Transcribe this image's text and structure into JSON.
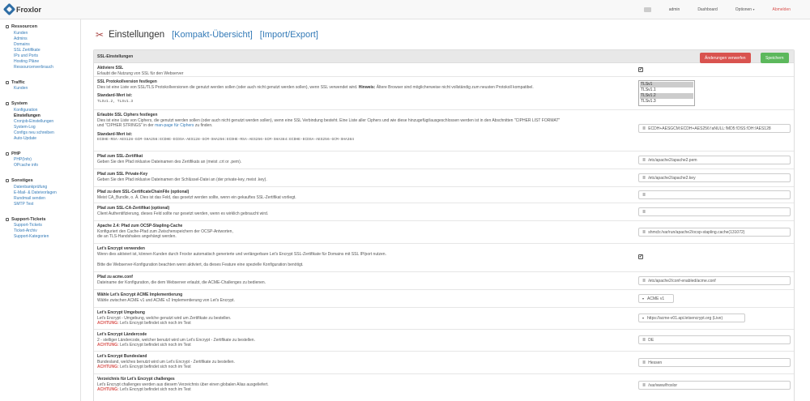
{
  "brand": {
    "name": "Froxlor"
  },
  "nav": {
    "user": "admin",
    "dashboard": "Dashboard",
    "options": "Optionen",
    "logout": "Abmelden"
  },
  "sidebar": [
    {
      "head": "Ressourcen",
      "items": [
        "Kunden",
        "Admins",
        "Domains",
        "SSL Zertifikate",
        "IPs und Ports",
        "Hosting Pläne",
        "Ressourcenverbrauch"
      ]
    },
    {
      "head": "Traffic",
      "items": [
        "Kunden"
      ]
    },
    {
      "head": "System",
      "items": [
        "Konfiguration",
        "Einstellungen",
        "Cronjob-Einstellungen",
        "System-Log",
        "Configs neu schreiben",
        "Auto-Update"
      ],
      "active": "Einstellungen"
    },
    {
      "head": "PHP",
      "items": [
        "PHP(Info)",
        "OPcache info"
      ]
    },
    {
      "head": "Sonstiges",
      "items": [
        "Datenbankprüfung",
        "E-Mail- & Dateivorlagen",
        "Rundmail senden",
        "SMTP Test"
      ]
    },
    {
      "head": "Support-Tickets",
      "items": [
        "Support-Tickets",
        "Ticket-Archiv",
        "Support-Kategorien"
      ]
    }
  ],
  "page": {
    "title": "Einstellungen",
    "compact_link": "[Kompakt-Übersicht]",
    "import_link": "[Import/Export]"
  },
  "panel": {
    "title": "SSL-Einstellungen",
    "discard": "Änderungen verwerfen",
    "save": "Speichern"
  },
  "settings": {
    "activate_ssl": {
      "title": "Aktiviere SSL",
      "desc": "Erlaubt die Nutzung von SSL für den Webserver",
      "checked": "✔"
    },
    "protocol": {
      "title": "SSL Protokollversion festlegen",
      "desc": "Dies ist eine Liste von SSL/TLS Protokollversionen die genutzt werden sollen (oder auch nicht genutzt werden sollen), wenn SSL verwendet wird.",
      "hint_label": "Hinweis:",
      "hint": "Ältere Browser sind möglicherweise nicht vollständig zum neusten Protokoll kompatibel.",
      "default_label": "Standard-Wert ist:",
      "default_value": "TLSv1.2, TLSv1.3",
      "options": [
        "TLSv1",
        "TLSv1.1",
        "TLSv1.2",
        "TLSv1.3"
      ],
      "selected": [
        "TLSv1",
        "TLSv1.2"
      ]
    },
    "ciphers": {
      "title": "Erlaubte SSL Ciphers festlegen",
      "desc": "Dies ist eine Liste von Ciphers, die genutzt werden sollen (oder auch nicht genutzt werden sollen), wenn eine SSL Verbindung besteht. Eine Liste aller Ciphers und wie diese hinzugefügt/ausgeschlossen werden ist in den Abschnitten \"CIPHER LIST FORMAT\"",
      "desc2_pre": "und \"CIPHER STRINGS\" in der",
      "desc2_link": "man-page für Ciphers",
      "desc2_post": "zu finden.",
      "default_label": "Standard-Wert ist:",
      "default_value": "ECDHE-RSA-AES128-GCM-SHA256:ECDHE-ECDSA-AES128-GCM-SHA256:ECDHE-RSA-AES256-GCM-SHA384:ECDHE-ECDSA-AES256-GCM-SHA384",
      "value": "ECDH+AESGCM:ECDH+AES256:!aNULL:!MD5:!DSS:!DH:!AES128"
    },
    "cert_file": {
      "title": "Pfad zum SSL-Zertifikat",
      "desc": "Geben Sie den Pfad inklusive Dateinamen des Zertifikats an (meist .crt or .pem).",
      "value": "/etc/apache2/apache2.pem"
    },
    "key_file": {
      "title": "Pfad zum SSL Private-Key",
      "desc": "Geben Sie den Pfad inklusive Dateinamen der Schlüssel-Datei an (der private-key, meist .key).",
      "value": "/etc/apache2/apache2.key"
    },
    "chain_file": {
      "title": "Pfad zu dem SSL-CertificateChainFile (optional)",
      "desc": "Meist CA_Bundle, o. Ä. Dies ist das Feld, das gesetzt werden sollte, wenn ein gekauftes SSL-Zertifikat vorliegt.",
      "value": ""
    },
    "ca_file": {
      "title": "Pfad zum SSL-CA-Zertifikat (optional)",
      "desc": "Client Authentifizierung, dieses Feld sollte nur gesetzt werden, wenn es wirklich gebraucht wird.",
      "value": ""
    },
    "stapling": {
      "title": "Apache 2.4: Pfad zum OCSP-Stapling-Cache",
      "desc": "Konfiguriert den Cache-Pfad zum Zwischenspeichern der OCSP-Antworten,",
      "desc2": "die an TLS-Handshakes angehängt werden.",
      "value": "shmcb:/var/run/apache2/ocsp-stapling.cache(131072)"
    },
    "letsencrypt": {
      "title": "Let's Encrypt verwenden",
      "desc": "Wenn dies aktiviert ist, können Kunden durch Froxlor automatisch generierte und verlängerbare Let's Encrypt SSL-Zertifikate für Domains mit SSL IP/port nutzen.",
      "desc2": "Bitte die Webserver-Konfiguration beachten wenn aktiviert, da dieses Feature eine spezielle Konfiguration benötigt.",
      "checked": "✔"
    },
    "acme_conf": {
      "title": "Pfad zu acme.conf",
      "desc": "Dateiname der Konfiguration, die dem Webserver erlaubt, die ACME-Challenges zu bedienen.",
      "value": "/etc/apache2/conf-enabled/acme.conf"
    },
    "acme_impl": {
      "title": "Wähle Let's Encrypt ACME Implementierung",
      "desc": "Wähle zwischen ACME v1 und ACME v2 Implementierung von Let's Encrypt.",
      "value": "ACME v1"
    },
    "le_env": {
      "title": "Let's Encrypt Umgebung",
      "desc": "Let's Encrypt - Umgebung, welche genutzt wird um Zertifikate zu bestellen.",
      "warn": "ACHTUNG:",
      "warn_text": "Let's Encrypt befindet sich noch im Test",
      "value": "https://acme-v01.api.letsencrypt.org (Live)"
    },
    "le_country": {
      "title": "Let's Encrypt Ländercode",
      "desc": "2 - stelliger Ländercode, welcher benutzt wird um Let's Encrypt - Zertifikate zu bestellen.",
      "warn": "ACHTUNG:",
      "warn_text": "Let's Encrypt befindet sich noch im Test",
      "value": "DE"
    },
    "le_state": {
      "title": "Let's Encrypt Bundesland",
      "desc": "Bundesland, welches benutzt wird um Let's Encrypt - Zertifikate zu bestellen.",
      "warn": "ACHTUNG:",
      "warn_text": "Let's Encrypt befindet sich noch im Test",
      "value": "Hessen"
    },
    "le_dir": {
      "title": "Verzeichnis für Let's Encrypt challenges",
      "desc": "Let's Encrypt challenges werden aus diesem Verzeichnis über einen globalen Alias ausgeliefert.",
      "warn": "ACHTUNG:",
      "warn_text": "Let's Encrypt befindet sich noch im Test",
      "value": "/var/www/froxlor"
    }
  },
  "icons": {
    "field": "list-icon",
    "settings": "tools-icon",
    "caret": "caret-down-icon"
  }
}
